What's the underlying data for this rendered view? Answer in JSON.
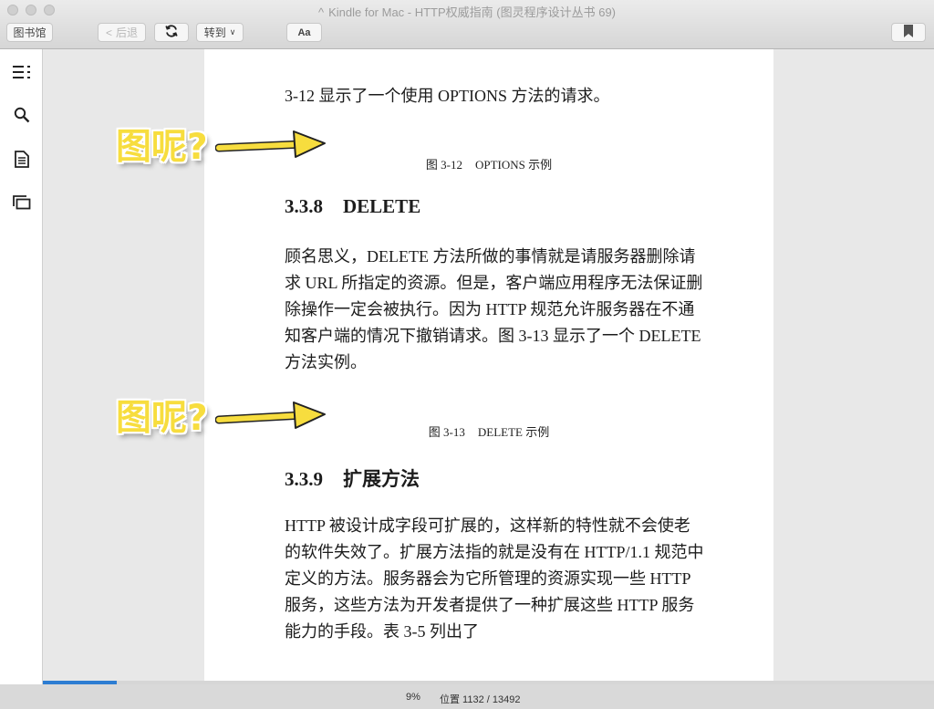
{
  "window": {
    "title_prefix": "^",
    "title": "Kindle for Mac - HTTP权威指南 (图灵程序设计丛书 69)"
  },
  "toolbar": {
    "library_label": "图书馆",
    "back_chevron": "<",
    "back_label": "后退",
    "sync_icon": "sync-icon",
    "goto_label": "转到",
    "goto_dropdown": "∨",
    "font_label": "Aa",
    "bookmark_icon": "bookmark-icon"
  },
  "sidebar": {
    "items": [
      {
        "icon": "table-of-contents-icon"
      },
      {
        "icon": "search-icon"
      },
      {
        "icon": "notes-icon"
      },
      {
        "icon": "flashcards-icon"
      }
    ]
  },
  "page": {
    "intro": "3-12 显示了一个使用 OPTIONS 方法的请求。",
    "caption1": {
      "num": "图 3-12",
      "text": "OPTIONS 示例"
    },
    "section1": {
      "num": "3.3.8",
      "title": "DELETE"
    },
    "para1": "顾名思义，DELETE 方法所做的事情就是请服务器删除请求 URL 所指定的资源。但是，客户端应用程序无法保证删除操作一定会被执行。因为 HTTP 规范允许服务器在不通知客户端的情况下撤销请求。图 3-13 显示了一个 DELETE 方法实例。",
    "caption2": {
      "num": "图 3-13",
      "text": "DELETE 示例"
    },
    "section2": {
      "num": "3.3.9",
      "title": "扩展方法"
    },
    "para2": "HTTP 被设计成字段可扩展的，这样新的特性就不会使老的软件失效了。扩展方法指的就是没有在 HTTP/1.1 规范中定义的方法。服务器会为它所管理的资源实现一些 HTTP 服务，这些方法为开发者提供了一种扩展这些 HTTP 服务能力的手段。表 3-5 列出了"
  },
  "annotations": {
    "first": "图呢?",
    "second": "图呢?",
    "color": "#f7dd3e"
  },
  "status": {
    "progress_fraction": 0.083,
    "percent": "9%",
    "location": "位置 1132 / 13492",
    "progress_color": "#2d7dd2"
  }
}
